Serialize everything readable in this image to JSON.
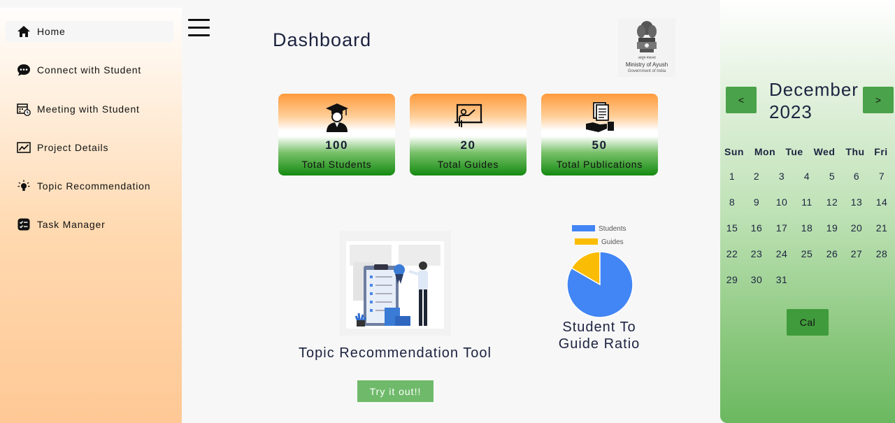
{
  "sidebar": {
    "items": [
      {
        "label": "Home",
        "icon": "home-icon"
      },
      {
        "label": "Connect with Student",
        "icon": "chat-icon"
      },
      {
        "label": "Meeting with Student",
        "icon": "calendar-clock-icon"
      },
      {
        "label": "Project Details",
        "icon": "chart-icon"
      },
      {
        "label": "Topic Recommendation",
        "icon": "lightbulb-icon"
      },
      {
        "label": "Task Manager",
        "icon": "checklist-icon"
      }
    ]
  },
  "header": {
    "title": "Dashboard",
    "emblem": {
      "hindi": "आयुष मंत्रालय",
      "line1": "Ministry of Ayush",
      "line2": "Government of India"
    }
  },
  "stats": [
    {
      "value": "100",
      "label": "Total Students",
      "icon": "graduate-icon"
    },
    {
      "value": "20",
      "label": "Total Guides",
      "icon": "teacher-board-icon"
    },
    {
      "value": "50",
      "label": "Total Publications",
      "icon": "publications-hand-icon"
    }
  ],
  "tool": {
    "title": "Topic Recommendation Tool",
    "button": "Try it out!!"
  },
  "chart_data": {
    "type": "pie",
    "title": "Student To Guide Ratio",
    "labels": [
      "Students",
      "Guides"
    ],
    "values": [
      100,
      20
    ],
    "colors": [
      "#4285f4",
      "#fbbc05"
    ],
    "legend": "top"
  },
  "calendar": {
    "prev": "<",
    "next": ">",
    "month": "December",
    "year": "2023",
    "weekdays": [
      "Sun",
      "Mon",
      "Tue",
      "Wed",
      "Thu",
      "Fri"
    ],
    "weeks": [
      [
        "1",
        "2",
        "3",
        "4",
        "5",
        "6",
        "7"
      ],
      [
        "8",
        "9",
        "10",
        "11",
        "12",
        "13",
        "14"
      ],
      [
        "15",
        "16",
        "17",
        "18",
        "19",
        "20",
        "21"
      ],
      [
        "22",
        "23",
        "24",
        "25",
        "26",
        "27",
        "28"
      ],
      [
        "29",
        "30",
        "31"
      ]
    ],
    "action": "Cal"
  },
  "colors": {
    "accent_green": "#4aa24a",
    "saffron": "#ff9a3c",
    "india_green": "#138a10"
  }
}
